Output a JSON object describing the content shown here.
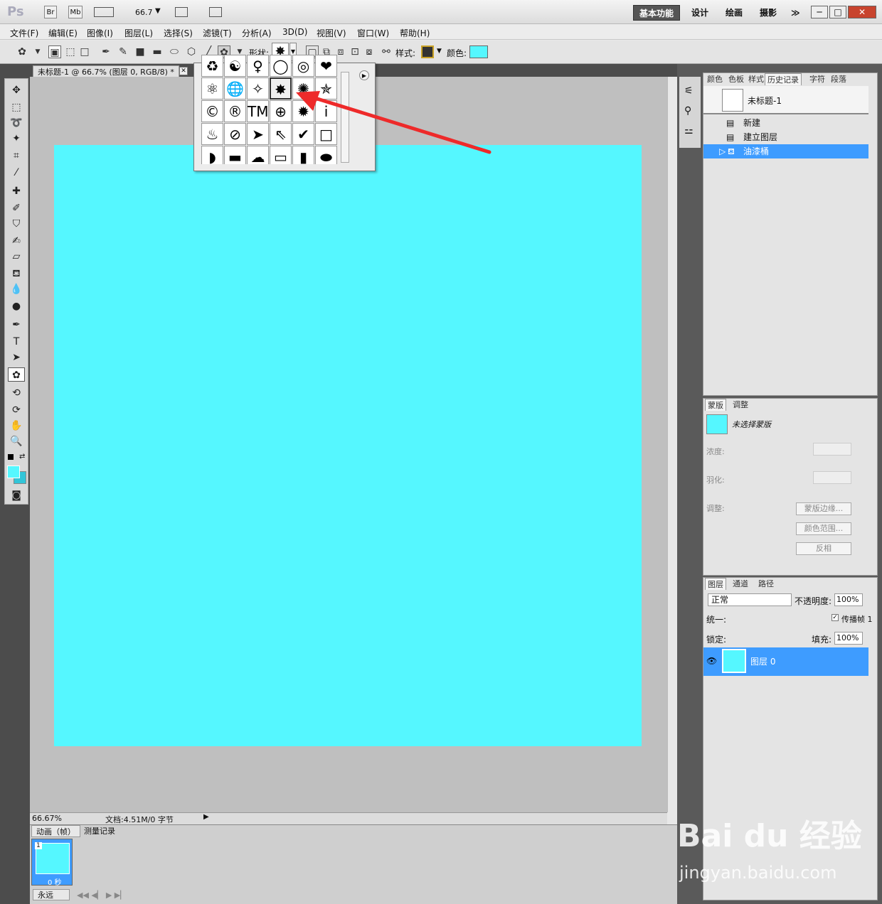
{
  "titlebar": {
    "logo": "Ps",
    "br": "Br",
    "mb": "Mb",
    "zoom": "66.7",
    "workspaces": [
      "基本功能",
      "设计",
      "绘画",
      "摄影"
    ],
    "more": "≫"
  },
  "menubar": [
    "文件(F)",
    "编辑(E)",
    "图像(I)",
    "图层(L)",
    "选择(S)",
    "滤镜(T)",
    "分析(A)",
    "3D(D)",
    "视图(V)",
    "窗口(W)",
    "帮助(H)"
  ],
  "options": {
    "shape_label": "形状:",
    "style_label": "样式:",
    "color_label": "颜色:",
    "color_value": "#55f7ff"
  },
  "document": {
    "tab_title": "未标题-1 @ 66.7% (图层 0, RGB/8) *",
    "canvas_color": "#55f7ff",
    "zoom_status": "66.67%",
    "doc_status": "文档:4.51M/0 字节"
  },
  "shape_picker": {
    "rows": [
      [
        "♻",
        "☯",
        "♀",
        "◯",
        "◎",
        "❤"
      ],
      [
        "⚛",
        "🌐",
        "✧",
        "✸",
        "✺",
        "✯"
      ],
      [
        "©",
        "®",
        "TM",
        "⊕",
        "✹",
        "i"
      ],
      [
        "♨",
        "⊘",
        "➤",
        "⇖",
        "✔",
        "□"
      ],
      [
        "◗",
        "▬",
        "☁",
        "▭",
        "▮",
        "⬬"
      ]
    ],
    "selected": "✸"
  },
  "history": {
    "tabs": [
      "颜色",
      "色板",
      "样式",
      "历史记录",
      "字符",
      "段落"
    ],
    "active_tab": "历史记录",
    "snapshot": "未标题-1",
    "steps": [
      "新建",
      "建立图层",
      "油漆桶"
    ]
  },
  "masks": {
    "tabs": [
      "蒙版",
      "调整"
    ],
    "no_mask": "未选择蒙版",
    "density_label": "浓度:",
    "feather_label": "羽化:",
    "adjust_label": "调整:",
    "buttons": [
      "蒙版边缘...",
      "颜色范围...",
      "反相"
    ]
  },
  "layers": {
    "tabs": [
      "图层",
      "通道",
      "路径"
    ],
    "blend_mode": "正常",
    "opacity_label": "不透明度:",
    "opacity_value": "100%",
    "unify_label": "统一:",
    "propagate_label": "传播帧 1",
    "lock_label": "锁定:",
    "fill_label": "填充:",
    "fill_value": "100%",
    "layer_name": "图层 0"
  },
  "animation": {
    "tabs": [
      "动画（帧）",
      "测量记录"
    ],
    "frame_number": "1",
    "frame_delay": "0 秒",
    "loop": "永远"
  },
  "watermark": {
    "brand": "Bai du 经验",
    "url": "jingyan.baidu.com"
  }
}
